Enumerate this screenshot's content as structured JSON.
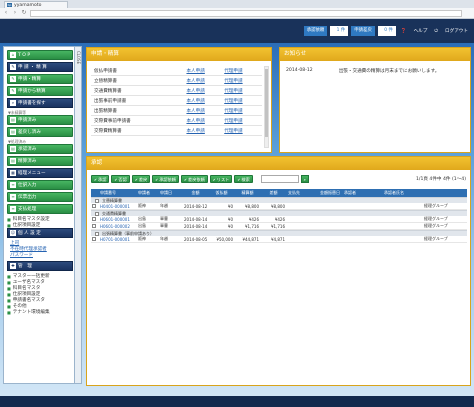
{
  "browser": {
    "tab_title": "yyamamoto",
    "favicon_text": "bp"
  },
  "header": {
    "unapproved_label": "承認依頼",
    "unapproved_value": "1 件",
    "pending_label": "申請差戻",
    "pending_value": "0 件",
    "help": "ヘルプ",
    "logout": "ログアウト"
  },
  "sidebar": {
    "close_label": "CLOSE",
    "top": "T O P",
    "apply_header": "申 請 ・ 精 算",
    "apply_items": [
      "申請・精算",
      "申請から精算"
    ],
    "search_header": "申請書を探す",
    "note_unprocessed": "▼未精算等",
    "search_items": [
      "申請済み",
      "差戻し済み"
    ],
    "note_processed": "▼処理済み",
    "processed_items": [
      "承認済み",
      "精算済み"
    ],
    "accounting_header": "経理メニュー",
    "accounting_items": [
      "仕訳入力",
      "伝票出力",
      "支払処理"
    ],
    "accounting_bullets": [
      "科目名マスタ設定",
      "仕訳項目設定"
    ],
    "personal_header": "個 人 設 定",
    "personal_links": [
      "上司",
      "不在時代理承認者",
      "パスワード"
    ],
    "admin_header": "管　理",
    "admin_bullets": [
      "マスター一括更新",
      "ユーザ名マスタ",
      "科目名マスタ",
      "仕訳項目設定",
      "申請書名マスタ",
      "その他",
      "テナント環境編集"
    ]
  },
  "apply_panel": {
    "title": "申請・精算",
    "rows": [
      {
        "doc": "仮払申請書",
        "own": "本人申請",
        "proxy": "代理申請"
      },
      {
        "doc": "立替精算書",
        "own": "本人申請",
        "proxy": "代理申請"
      },
      {
        "doc": "交通費精算書",
        "own": "本人申請",
        "proxy": "代理申請"
      },
      {
        "doc": "出張事前申請書",
        "own": "本人申請",
        "proxy": "代理申請"
      },
      {
        "doc": "出張精算書",
        "own": "本人申請",
        "proxy": "代理申請"
      },
      {
        "doc": "交際費事前申請書",
        "own": "本人申請",
        "proxy": "代理申請"
      },
      {
        "doc": "交際費精算書",
        "own": "本人申請",
        "proxy": "代理申請"
      }
    ]
  },
  "notice_panel": {
    "title": "お知らせ",
    "rows": [
      {
        "date": "2014-08-12",
        "text": "出張・交通費の精算は月末までにお願いします。"
      }
    ]
  },
  "pending_panel": {
    "title": "承認",
    "toolbar": [
      "承認",
      "否認",
      "差戻",
      "承認依頼",
      "差戻依頼",
      "リスト",
      "検索"
    ],
    "count_text": "1/1頁 4件中 4件 (1～4)",
    "columns": [
      "",
      "申請番号",
      "申請者",
      "申請日",
      "金額",
      "仮払額",
      "精算額",
      "差額",
      "支払先",
      "金額振替日",
      "承認者",
      "承認者氏名"
    ],
    "groups": [
      {
        "label": "立替精算書",
        "rows": [
          [
            "H0401-000001",
            "阪神",
            "年越",
            "2014-08-12",
            "¥0",
            "¥8,800",
            "¥8,800",
            "",
            "",
            "",
            "",
            "経理グループ"
          ]
        ]
      },
      {
        "label": "交通費精算書",
        "rows": [
          [
            "H0601-000001",
            "出島",
            "軍曹",
            "2014-08-14",
            "¥0",
            "¥426",
            "¥426",
            "",
            "",
            "",
            "",
            "経理グループ"
          ],
          [
            "H0601-000002",
            "出島",
            "軍曹",
            "2014-08-14",
            "¥0",
            "¥1,716",
            "¥1,716",
            "",
            "",
            "",
            "",
            "経理グループ"
          ]
        ]
      },
      {
        "label": "出張精算書（事前申請あり）",
        "rows": [
          [
            "H0701-000001",
            "阪神",
            "年越",
            "2014-08-05",
            "¥50,000",
            "¥44,871",
            "¥4,871",
            "",
            "",
            "",
            "",
            "経理グループ"
          ]
        ]
      }
    ]
  }
}
